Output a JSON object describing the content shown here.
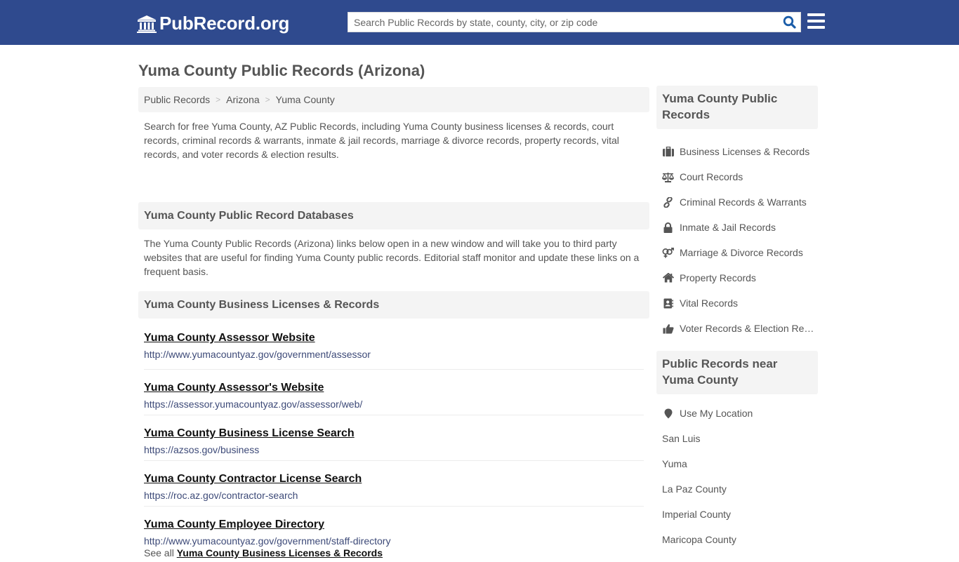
{
  "header": {
    "logo_text": "PubRecord.org",
    "search_placeholder": "Search Public Records by state, county, city, or zip code",
    "search_value": "",
    "colors": {
      "brand": "#2f4a8e",
      "search_icon": "#1a5ca8"
    }
  },
  "page": {
    "title": "Yuma County Public Records (Arizona)",
    "breadcrumb": [
      "Public Records",
      "Arizona",
      "Yuma County"
    ],
    "intro": "Search for free Yuma County, AZ Public Records, including Yuma County business licenses & records, court records, criminal records & warrants, inmate & jail records, marriage & divorce records, property records, vital records, and voter records & election results."
  },
  "databases": {
    "heading": "Yuma County Public Record Databases",
    "description": "The Yuma County Public Records (Arizona) links below open in a new window and will take you to third party websites that are useful for finding Yuma County public records. Editorial staff monitor and update these links on a frequent basis."
  },
  "business_section": {
    "heading": "Yuma County Business Licenses & Records",
    "links": [
      {
        "title": "Yuma County Assessor Website",
        "url": "http://www.yumacountyaz.gov/government/assessor"
      },
      {
        "title": "Yuma County Assessor's Website",
        "url": "https://assessor.yumacountyaz.gov/assessor/web/"
      },
      {
        "title": "Yuma County Business License Search",
        "url": "https://azsos.gov/business"
      },
      {
        "title": "Yuma County Contractor License Search",
        "url": "https://roc.az.gov/contractor-search"
      },
      {
        "title": "Yuma County Employee Directory",
        "url": "http://www.yumacountyaz.gov/government/staff-directory"
      }
    ],
    "see_all_prefix": "See all",
    "see_all_link": "Yuma County Business Licenses & Records"
  },
  "sidebar": {
    "records_heading": "Yuma County Public Records",
    "records": [
      {
        "icon": "briefcase-icon",
        "label": "Business Licenses & Records"
      },
      {
        "icon": "balance-scale-icon",
        "label": "Court Records"
      },
      {
        "icon": "link-icon",
        "label": "Criminal Records & Warrants"
      },
      {
        "icon": "lock-icon",
        "label": "Inmate & Jail Records"
      },
      {
        "icon": "venus-mars-icon",
        "label": "Marriage & Divorce Records"
      },
      {
        "icon": "home-icon",
        "label": "Property Records"
      },
      {
        "icon": "address-book-icon",
        "label": "Vital Records"
      },
      {
        "icon": "thumbs-up-icon",
        "label": "Voter Records & Election Results"
      }
    ],
    "near_heading": "Public Records near Yuma County",
    "use_location": "Use My Location",
    "near": [
      "San Luis",
      "Yuma",
      "La Paz County",
      "Imperial County",
      "Maricopa County"
    ]
  }
}
